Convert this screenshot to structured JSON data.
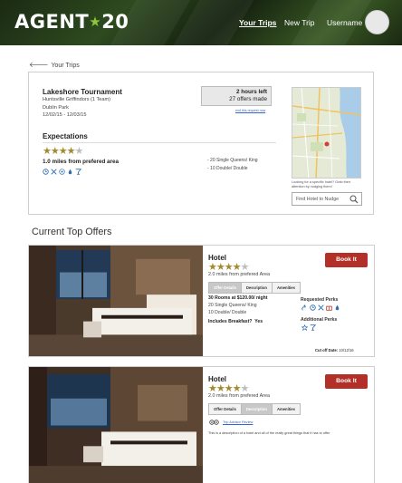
{
  "header": {
    "logo": "AGENT",
    "logo_num": "20",
    "nav": [
      "Your Trips",
      "New Trip",
      "Username"
    ]
  },
  "back_link": "Your Trips",
  "trip": {
    "name": "Lakeshore Tournament",
    "team": "Huntsville Griffindors (1 Team)",
    "location": "Dublin Park",
    "dates": "12/02/15 - 12/03/15",
    "time_left": "2 hours left",
    "offers_made": "27 offers made",
    "extend_link": "end this request now",
    "expectations_title": "Expectations",
    "stars": 4,
    "distance": "1.0 miles from prefered area",
    "rooms": [
      "- 20 Single Queens/ King",
      "- 10 Double/ Double"
    ],
    "amenity_icons": [
      "clock-icon",
      "tools-icon",
      "wifi-icon",
      "droplet-icon",
      "cocktail-icon"
    ],
    "map_caption": "Looking for a specific hotel? Grab their attention by nudging them!",
    "find_placeholder": "Find Hotel to Nudge"
  },
  "section_title": "Current Top Offers",
  "offers": [
    {
      "title": "Hotel",
      "stars": 4,
      "distance": "2.0 miles from prefered Area",
      "book": "Book It",
      "tabs": [
        "Offer Details",
        "Description",
        "Amenities"
      ],
      "active_tab": 0,
      "rooms_price": "30 Rooms at $120.00/ night",
      "room_lines": [
        "20 Single Queens/ King",
        "10 Double/ Double"
      ],
      "breakfast_label": "Includes Breakfast?",
      "breakfast_value": "Yes",
      "requested_perks": "Requested Perks",
      "additional_perks": "Additional Perks",
      "cutoff_label": "Cut off Date:",
      "cutoff_date": "10/12/16"
    },
    {
      "title": "Hotel",
      "stars": 4,
      "distance": "2.0 miles from prefered Area",
      "book": "Book It",
      "tabs": [
        "Offer Details",
        "Description",
        "Amenities"
      ],
      "active_tab": 1,
      "review_link": "Trip Advisor Review",
      "description": "This is a description of a hotel and all of the really great things that it has to offer"
    }
  ],
  "colors": {
    "book": "#b23027",
    "star": "#a48a2e",
    "icon": "#2c6fb1",
    "header": "#1f3016"
  }
}
